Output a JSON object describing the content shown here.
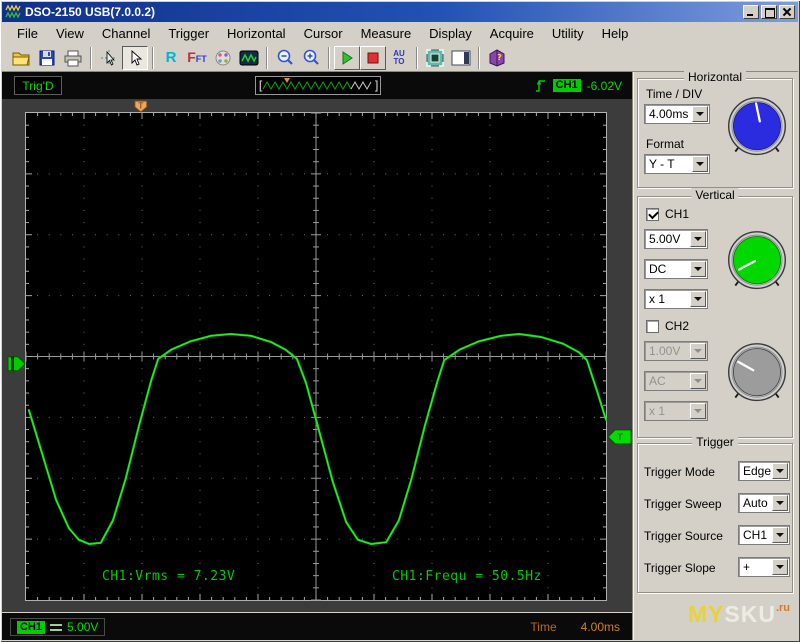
{
  "window": {
    "title": "DSO-2150 USB(7.0.0.2)"
  },
  "titlebar": {
    "buttons": [
      "minimize",
      "maximize",
      "close"
    ]
  },
  "menu": {
    "items": [
      "File",
      "View",
      "Channel",
      "Trigger",
      "Horizontal",
      "Cursor",
      "Measure",
      "Display",
      "Acquire",
      "Utility",
      "Help"
    ]
  },
  "toolbar": {
    "buttons": [
      "open",
      "save",
      "print",
      "cursor-measure",
      "pointer",
      "reference",
      "fft",
      "display-color",
      "waveform-window",
      "zoom-out",
      "zoom-in",
      "start",
      "stop",
      "auto-setup",
      "self-calibration",
      "window-layout",
      "help"
    ],
    "r_label": "R",
    "fft_main": "F",
    "fft_sub": "FT",
    "auto_line1": "AU",
    "auto_line2": "TO"
  },
  "status_top": {
    "trig_status": "Trig'D",
    "trigger_source_badge": "CH1",
    "trigger_level": "-6.02V"
  },
  "status_bottom": {
    "channel_badge": "CH1",
    "volts_per_div": "5.00V",
    "time_label": "Time",
    "time_per_div": "4.00ms"
  },
  "panel": {
    "horizontal": {
      "title": "Horizontal",
      "time_div_label": "Time / DIV",
      "time_div_value": "4.00ms",
      "format_label": "Format",
      "format_value": "Y - T"
    },
    "vertical": {
      "title": "Vertical",
      "ch1_label": "CH1",
      "ch1_volts": "5.00V",
      "ch1_coupling": "DC",
      "ch1_probe": "x 1",
      "ch2_label": "CH2",
      "ch2_volts": "1.00V",
      "ch2_coupling": "AC",
      "ch2_probe": "x 1"
    },
    "trigger": {
      "title": "Trigger",
      "rows": [
        {
          "label": "Trigger Mode",
          "value": "Edge"
        },
        {
          "label": "Trigger Sweep",
          "value": "Auto"
        },
        {
          "label": "Trigger Source",
          "value": "CH1"
        },
        {
          "label": "Trigger Slope",
          "value": "+"
        }
      ]
    }
  },
  "watermark": {
    "part1": "MY",
    "part2": "SKU",
    "part3": ".ru"
  },
  "colors": {
    "trace": "#00d800",
    "ch1_accent": "#00cc00",
    "time_accent": "#d08020",
    "horizontal_knob": "#2b2bdf",
    "ch1_knob": "#00d800",
    "ch2_knob": "#9c9c9c",
    "trigger_marker": "#eda45c"
  },
  "chart_data": {
    "type": "line",
    "title": "DSO-2150 CH1 trace (clipped sine)",
    "x_axis": {
      "unit": "divisions",
      "range": [
        0,
        10
      ],
      "time_per_div": "4.00ms"
    },
    "y_axis": {
      "unit": "divisions",
      "range": [
        -4,
        4
      ],
      "volts_per_div": "5.00V"
    },
    "grid": {
      "cols": 10,
      "rows": 8,
      "minor_per_major": 5
    },
    "annotations": [
      "CH1:Vrms = 7.23V",
      "CH1:Frequ = 50.5Hz"
    ],
    "markers": {
      "label": "T",
      "trigger_position_div": 1.98,
      "trigger_level_div": -1.32,
      "ch1_ground_div": -0.12
    },
    "series": [
      {
        "name": "CH1",
        "color": "#00d800",
        "points_div": [
          [
            0.05,
            -0.88
          ],
          [
            0.26,
            -1.54
          ],
          [
            0.52,
            -2.36
          ],
          [
            0.74,
            -2.82
          ],
          [
            0.91,
            -3.01
          ],
          [
            1.09,
            -3.08
          ],
          [
            1.29,
            -3.06
          ],
          [
            1.5,
            -2.69
          ],
          [
            1.72,
            -2.0
          ],
          [
            1.95,
            -1.13
          ],
          [
            2.16,
            -0.39
          ],
          [
            2.28,
            -0.04
          ],
          [
            2.5,
            0.11
          ],
          [
            2.84,
            0.25
          ],
          [
            3.19,
            0.34
          ],
          [
            3.53,
            0.37
          ],
          [
            3.88,
            0.34
          ],
          [
            4.22,
            0.24
          ],
          [
            4.48,
            0.11
          ],
          [
            4.67,
            -0.04
          ],
          [
            4.83,
            -0.44
          ],
          [
            5.05,
            -1.21
          ],
          [
            5.29,
            -2.06
          ],
          [
            5.52,
            -2.72
          ],
          [
            5.72,
            -3.01
          ],
          [
            5.95,
            -3.08
          ],
          [
            6.21,
            -3.05
          ],
          [
            6.43,
            -2.69
          ],
          [
            6.64,
            -2.03
          ],
          [
            6.88,
            -1.13
          ],
          [
            7.09,
            -0.42
          ],
          [
            7.21,
            -0.06
          ],
          [
            7.47,
            0.11
          ],
          [
            7.81,
            0.25
          ],
          [
            8.19,
            0.34
          ],
          [
            8.5,
            0.37
          ],
          [
            8.88,
            0.32
          ],
          [
            9.26,
            0.21
          ],
          [
            9.53,
            0.07
          ],
          [
            9.67,
            -0.06
          ],
          [
            9.84,
            -0.55
          ],
          [
            10.0,
            -1.04
          ]
        ]
      }
    ]
  }
}
